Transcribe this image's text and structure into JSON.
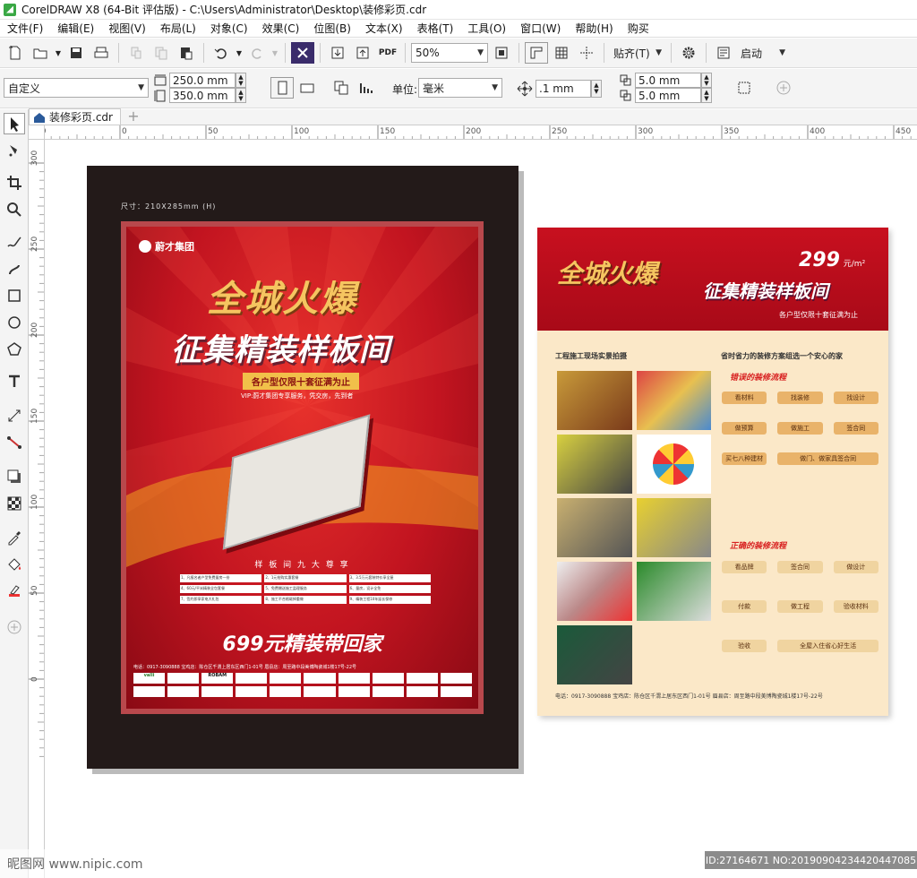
{
  "window": {
    "title": "CorelDRAW X8 (64-Bit 评估版) - C:\\Users\\Administrator\\Desktop\\装修彩页.cdr"
  },
  "menu": [
    {
      "label": "文件(F)"
    },
    {
      "label": "编辑(E)"
    },
    {
      "label": "视图(V)"
    },
    {
      "label": "布局(L)"
    },
    {
      "label": "对象(C)"
    },
    {
      "label": "效果(C)"
    },
    {
      "label": "位图(B)"
    },
    {
      "label": "文本(X)"
    },
    {
      "label": "表格(T)"
    },
    {
      "label": "工具(O)"
    },
    {
      "label": "窗口(W)"
    },
    {
      "label": "帮助(H)"
    },
    {
      "label": "购买"
    }
  ],
  "toolbar": {
    "zoom": "50%",
    "snap_label": "贴齐(T)",
    "launch_label": "启动",
    "pdf_label": "PDF"
  },
  "propbar": {
    "page_preset": "自定义",
    "width": "250.0 mm",
    "height": "350.0 mm",
    "units_label": "单位:",
    "units": "毫米",
    "nudge": ".1 mm",
    "dup_x": "5.0 mm",
    "dup_y": "5.0 mm"
  },
  "doc_tab": {
    "name": "装修彩页.cdr"
  },
  "ruler": {
    "h_ticks": [
      "50",
      "0",
      "50",
      "100",
      "150",
      "200",
      "250",
      "300",
      "350",
      "400",
      "450"
    ],
    "v_ticks": [
      "300",
      "250",
      "200",
      "150",
      "100",
      "50",
      "0"
    ]
  },
  "poster_left": {
    "size_note": "尺寸：210X285mm (H)",
    "brand": "蔚才集团",
    "headline1": "全城火爆",
    "headline2": "征集精装样板间",
    "ribbon": "各户型仅限十套征满为止",
    "vip_line": "VIP:蔚才集团专享服务，凭交房，先到者",
    "section": "样 板 间 九 大 尊 享",
    "promo": "699元精装带回家",
    "contact": "电话：0917-3090888 宝鸡店：陈仓区千渭上居东区西门1-01号 眉县店：周至路中段美博陶瓷城1楼17号-22号",
    "benefits": [
      "1、凡报名者户型免费量房一份",
      "2、1元抢购实惠套餐",
      "3、3.5万元套装特价享全屋",
      "4、60元/平米精装全包套餐",
      "5、免费赠送施工监理服务",
      "6、量房，设计全免",
      "7、签约即享家电大礼包",
      "8、施工不合格砸掉重做",
      "9、精装工程10年延长保修"
    ],
    "logos": [
      "valli",
      "",
      "ROBAM",
      "",
      "",
      "",
      "",
      "",
      "",
      "",
      "",
      "",
      "",
      "",
      "",
      "",
      "",
      "",
      "",
      "",
      "",
      "",
      "",
      "",
      "EAPOLY",
      "",
      "",
      "",
      "",
      ""
    ]
  },
  "poster_right": {
    "price": "299",
    "price_unit": "元/m²",
    "headline1": "全城火爆",
    "headline2": "征集精装样板间",
    "sub": "各户型仅限十套征满为止",
    "col1_title": "工程施工现场实景拍摄",
    "col2_title": "省时省力的装修方案组选一个安心的家",
    "wrong_title": "错误的装修流程",
    "right_title": "正确的装修流程",
    "wrong_steps": [
      "看材料",
      "找装修",
      "找设计",
      "做预算",
      "做施工",
      "签合同",
      "买七八种建材",
      "做门、做家具签合同"
    ],
    "right_steps": [
      "看品牌",
      "签合同",
      "做设计",
      "付款",
      "做工程",
      "验收材料",
      "验收",
      "全屋入住省心好生活"
    ],
    "footer": "电话：0917-3090888 宝鸡店：陈仓区千渭上居东区西门1-01号 眉县店：周至路中段美博陶瓷城1楼17号-22号"
  },
  "watermarks": {
    "left": "昵图网 www.nipic.com",
    "right": "ID:27164671 NO:20190904234420447085"
  }
}
